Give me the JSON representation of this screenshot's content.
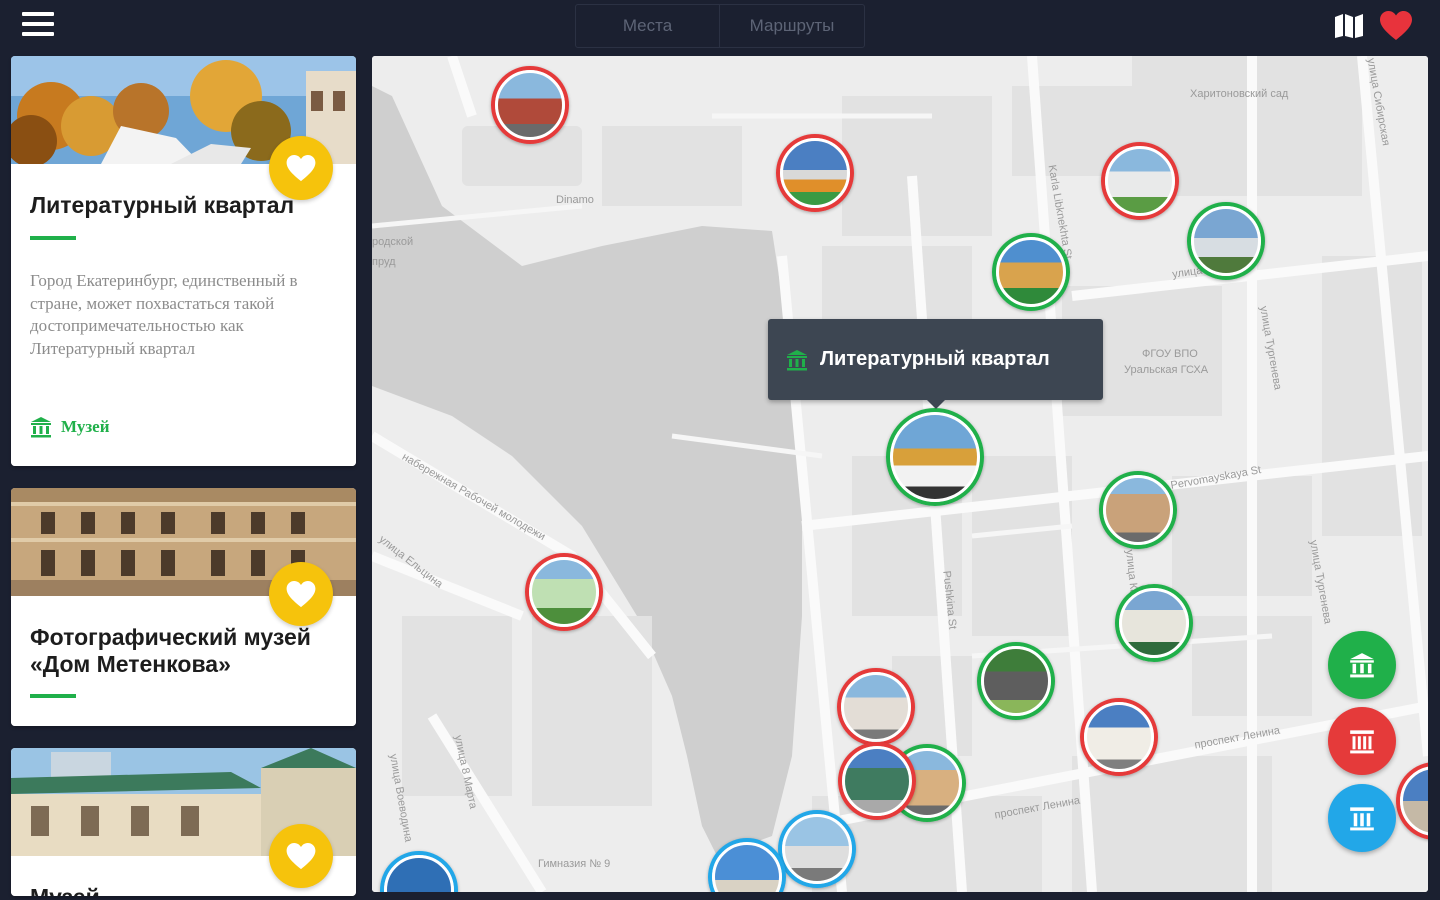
{
  "header": {
    "tabs": [
      {
        "label": "Места"
      },
      {
        "label": "Маршруты"
      }
    ]
  },
  "sidebar": {
    "cards": [
      {
        "title": "Литературный квартал",
        "description": "Город Екатеринбург, единственный в стране, может похвастаться такой достопримечательностью как Литературный квартал",
        "category": "Музей",
        "category_icon": "museum-icon"
      },
      {
        "title": "Фотографический музей «Дом Метенкова»"
      },
      {
        "title": "Музей"
      }
    ]
  },
  "map": {
    "labels": {
      "kharitonovsky": "Харитоновский сад",
      "dinamo": "Dinamo",
      "gorodskoy": "родской",
      "prud": "пруд",
      "karla_libknekhta": "Karla Libknekhta St",
      "tsetkin": "улица Цеткин",
      "ugsha": "ФГОУ ВПО",
      "ugsha2": "Уральская ГСХА",
      "turgeneva": "улица Тургенева",
      "pervomayskaya": "Pervomayskaya St",
      "naberezhnaya": "набережная Рабочей молодежи",
      "eltsina": "улица Ельцина",
      "pushkina": "Pushkina St",
      "karla_marksa": "улица Карла Маркса",
      "lenina1": "проспект Ленина",
      "lenina2": "проспект Ленина",
      "vosmogo_marta": "улица 8 Марта",
      "voevodina": "улица Воеводина",
      "gimnaziya": "Гимназия № 9",
      "sibirskaya": "улица Сибирская",
      "turgeneva2": "улица Тургенева"
    },
    "tooltip": {
      "title": "Литературный квартал",
      "icon": "museum-icon"
    },
    "fabs": [
      {
        "icon": "museum-icon",
        "color": "#20b04a"
      },
      {
        "icon": "theater-icon",
        "color": "#e53a3a"
      },
      {
        "icon": "columns-icon",
        "color": "#22a7e8"
      }
    ]
  },
  "colors": {
    "accent_green": "#20b04a",
    "accent_red": "#e53a3a",
    "accent_blue": "#22a7e8",
    "favorite_yellow": "#f6c30c",
    "topbar": "#1b2030",
    "heart_red": "#e8333c"
  }
}
